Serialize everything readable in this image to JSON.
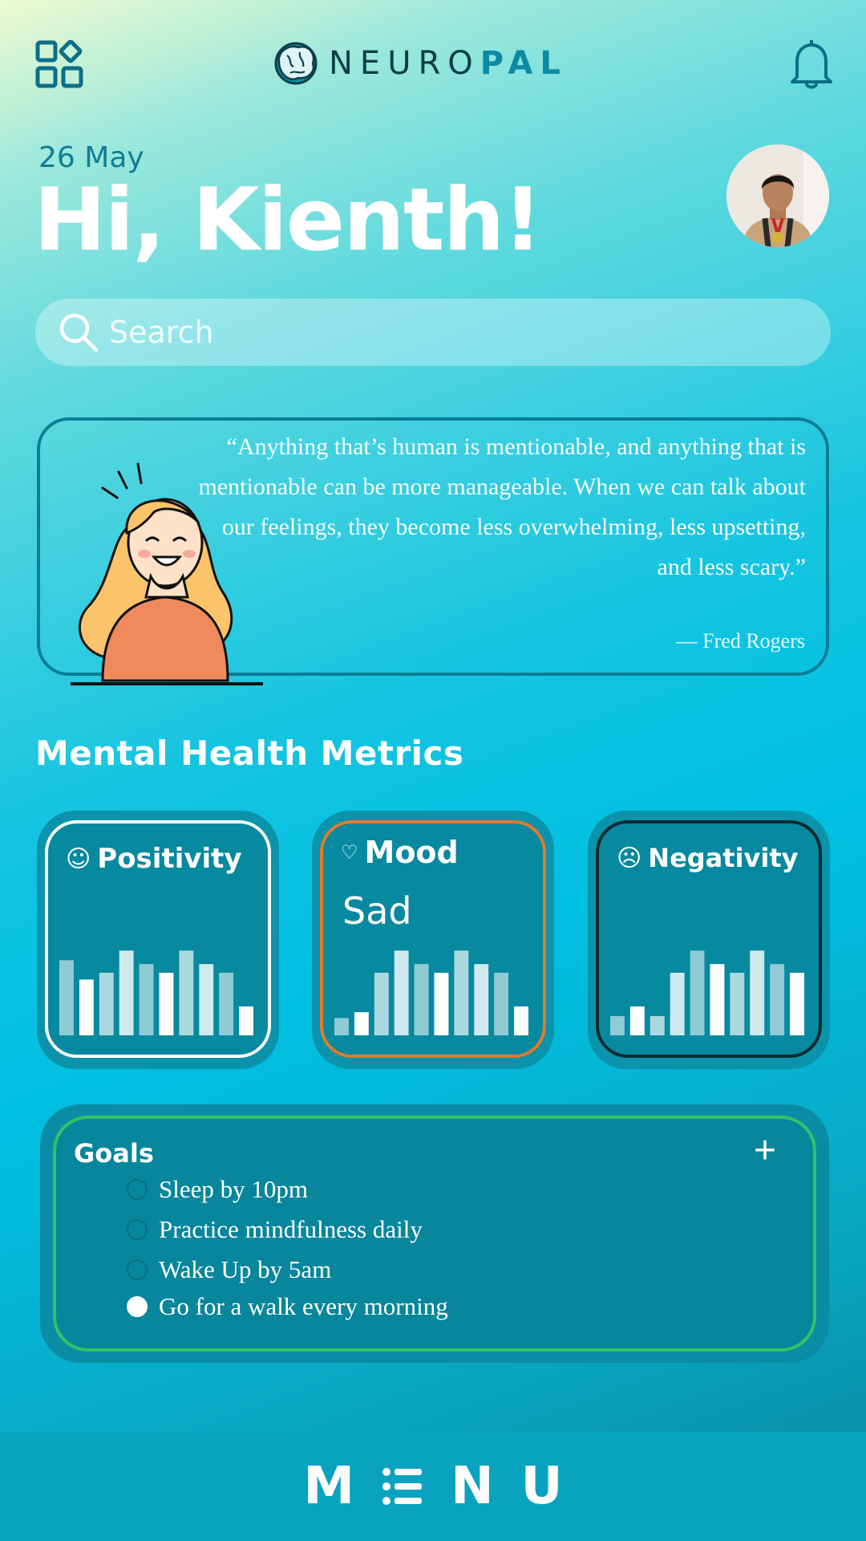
{
  "header": {
    "logo_text_main": "NEURO",
    "logo_text_accent": "PAL",
    "menu_icon": "grid-menu-icon",
    "notification_icon": "bell-icon"
  },
  "greeting": {
    "date": "26 May",
    "headline": "Hi, Kienth!"
  },
  "search": {
    "placeholder": "Search",
    "icon": "search-icon"
  },
  "quote": {
    "text": "“Anything that’s human is mentionable, and anything that is mentionable can be more manageable. When we can talk about our feelings, they become less overwhelming, less upsetting, and less scary.”",
    "author": "— Fred Rogers"
  },
  "metrics": {
    "title": "Mental Health Metrics",
    "cards": [
      {
        "label": "Positivity",
        "icon": "smile-icon",
        "value": "",
        "border_color": "#ffffff",
        "bars": [
          0.78,
          0.58,
          0.65,
          0.88,
          0.74,
          0.65,
          0.88,
          0.74,
          0.65,
          0.3
        ]
      },
      {
        "label": "Mood",
        "icon": "heart-icon",
        "value": "Sad",
        "border_color": "#e07b2c",
        "bars": [
          0.18,
          0.24,
          0.65,
          0.88,
          0.74,
          0.65,
          0.88,
          0.74,
          0.65,
          0.3
        ]
      },
      {
        "label": "Negativity",
        "icon": "frown-icon",
        "value": "",
        "border_color": "#0c2a30",
        "bars": [
          0.2,
          0.3,
          0.2,
          0.65,
          0.88,
          0.74,
          0.65,
          0.88,
          0.74,
          0.65
        ]
      }
    ]
  },
  "goals": {
    "title": "Goals",
    "add_label": "+",
    "items": [
      {
        "text": "Sleep by 10pm",
        "done": false
      },
      {
        "text": "Practice mindfulness daily",
        "done": false
      },
      {
        "text": "Wake Up by 5am",
        "done": false
      },
      {
        "text": "Go for a walk every morning",
        "done": true
      }
    ]
  },
  "bottom_nav": {
    "letter_1": "M",
    "letter_2": "N",
    "letter_3": "U",
    "icon": "list-icon"
  },
  "colors": {
    "accent_teal": "#0a8da4",
    "mood_orange": "#e07b2c",
    "goals_green": "#36c067"
  }
}
